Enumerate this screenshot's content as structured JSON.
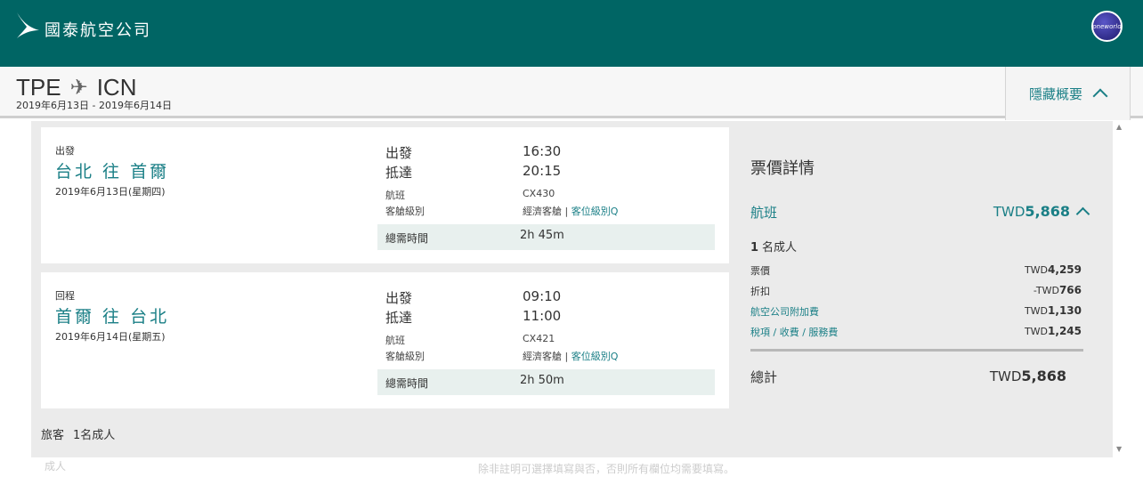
{
  "header": {
    "brand": "國泰航空公司",
    "alliance_badge": "oneworld",
    "colors": {
      "header_bg": "#006564",
      "accent": "#1a7f86"
    }
  },
  "summary": {
    "origin": "TPE",
    "destination": "ICN",
    "date_range": "2019年6月13日 - 2019年6月14日",
    "toggle_label": "隱藏概要",
    "plane_icon": "plane-icon"
  },
  "outbound": {
    "kind": "出發",
    "route": "台北 往 首爾",
    "date": "2019年6月13日(星期四)",
    "depart_label": "出發",
    "depart_time": "16:30",
    "arrive_label": "抵達",
    "arrive_time": "20:15",
    "flight_label": "航班",
    "flight_no": "CX430",
    "cabin_label": "客艙級別",
    "cabin_value": "經濟客艙 | ",
    "cabin_link": "客位級別Q",
    "duration_label": "總需時間",
    "duration": "2h 45m"
  },
  "inbound": {
    "kind": "回程",
    "route": "首爾 往 台北",
    "date": "2019年6月14日(星期五)",
    "depart_label": "出發",
    "depart_time": "09:10",
    "arrive_label": "抵達",
    "arrive_time": "11:00",
    "flight_label": "航班",
    "flight_no": "CX421",
    "cabin_label": "客艙級別",
    "cabin_value": "經濟客艙 | ",
    "cabin_link": "客位級別Q",
    "duration_label": "總需時間",
    "duration": "2h 50m"
  },
  "passengers": {
    "label": "旅客",
    "value": "1名成人"
  },
  "fare": {
    "title": "票價詳情",
    "flight_label": "航班",
    "flight_currency": "TWD",
    "flight_amount": "5,868",
    "adults_count": "1",
    "adults_label": "名成人",
    "lines": [
      {
        "label": "票價",
        "currency": "TWD",
        "amount": "4,259"
      },
      {
        "label": "折扣",
        "currency": "-TWD",
        "amount": "766"
      },
      {
        "label": "航空公司附加費",
        "currency": "TWD",
        "amount": "1,130"
      },
      {
        "label": "稅項 / 收費 / 服務費",
        "currency": "TWD",
        "amount": "1,245"
      }
    ],
    "total_label": "總計",
    "total_currency": "TWD",
    "total_amount": "5,868"
  },
  "footer": {
    "adult_label": "成人",
    "note": "除非註明可選擇填寫與否，否則所有欄位均需要填寫。"
  }
}
